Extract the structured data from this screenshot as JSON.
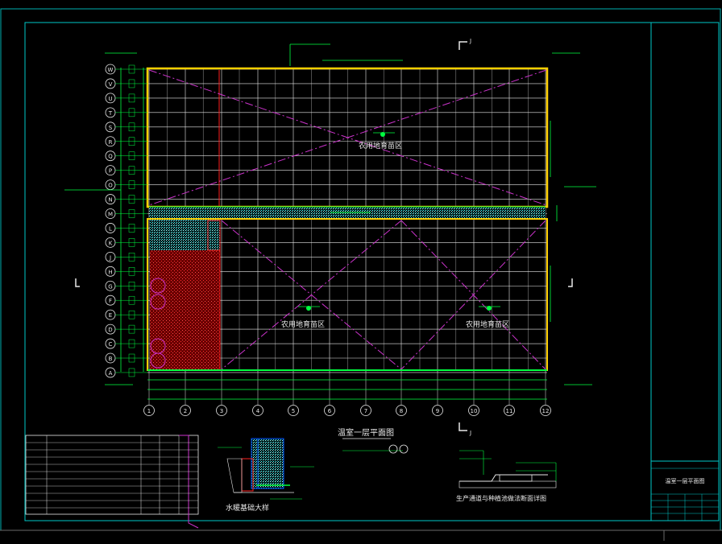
{
  "drawing": {
    "title": "温室一层平面图",
    "room_labels": [
      "农用地育苗区",
      "农用地育苗区",
      "农用地育苗区"
    ],
    "row_axis_labels": [
      "W",
      "V",
      "U",
      "T",
      "S",
      "R",
      "Q",
      "P",
      "O",
      "N",
      "M",
      "L",
      "K",
      "J",
      "H",
      "G",
      "F",
      "E",
      "D",
      "C",
      "B",
      "A"
    ],
    "col_axis_labels": [
      "1",
      "2",
      "3",
      "4",
      "5",
      "6",
      "7",
      "8",
      "9",
      "10",
      "11",
      "12"
    ],
    "section_mark": "J",
    "detail_titles": [
      "水暖基础大样",
      "生产通道与种植池做法断面详图"
    ]
  },
  "title_block": {
    "drawing_name": "温室一层平面图"
  },
  "colors": {
    "background": "#000000",
    "frame": "#00c8c8",
    "grid": "#e8e8e8",
    "wall": "#ffd000",
    "green": "#00ff40",
    "magenta": "#cc33cc",
    "red": "#ff2020",
    "cyan": "#00e5e5"
  }
}
